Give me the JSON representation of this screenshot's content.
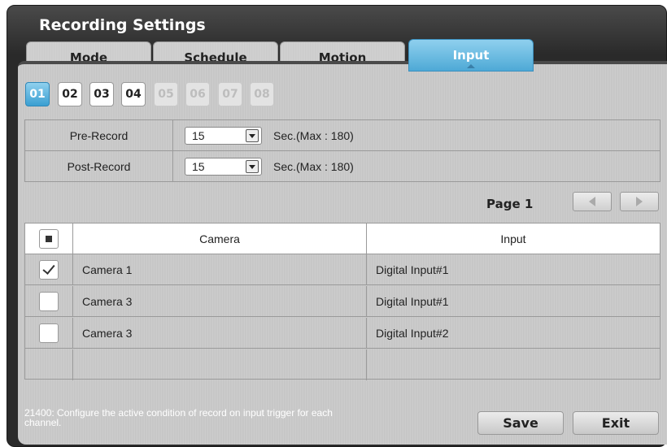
{
  "window": {
    "title": "Recording Settings"
  },
  "tabs": [
    {
      "label": "Mode"
    },
    {
      "label": "Schedule"
    },
    {
      "label": "Motion"
    },
    {
      "label": "Input",
      "active": true
    }
  ],
  "channels": [
    "01",
    "02",
    "03",
    "04",
    "05",
    "06",
    "07",
    "08"
  ],
  "settings": {
    "pre_record": {
      "label": "Pre-Record",
      "value": "15",
      "unit": "Sec.(Max : 180)"
    },
    "post_record": {
      "label": "Post-Record",
      "value": "15",
      "unit": "Sec.(Max : 180)"
    }
  },
  "pagination": {
    "label": "Page 1"
  },
  "table": {
    "headers": {
      "camera": "Camera",
      "input": "Input"
    },
    "rows": [
      {
        "camera": "Camera 1",
        "input": "Digital Input#1",
        "checked": true
      },
      {
        "camera": "Camera 3",
        "input": "Digital Input#1",
        "checked": false
      },
      {
        "camera": "Camera 3",
        "input": "Digital Input#2",
        "checked": false
      }
    ]
  },
  "footer": {
    "hint": "21400: Configure the active condition of record on input trigger for each channel.",
    "save_label": "Save",
    "exit_label": "Exit"
  },
  "colors": {
    "accent": "#4ea9d6",
    "frame": "#2a2a2a"
  }
}
